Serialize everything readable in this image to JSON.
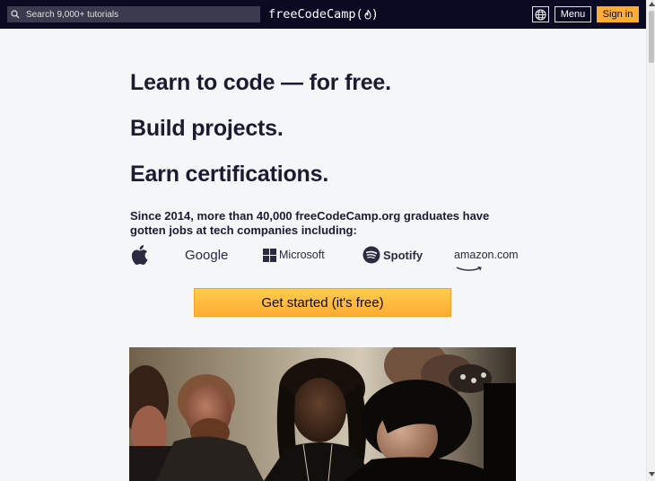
{
  "header": {
    "search_placeholder": "Search 9,000+ tutorials",
    "brand": "freeCodeCamp",
    "brand_suffix": "(",
    "brand_suffix_close": ")",
    "menu_label": "Menu",
    "signin_label": "Sign in",
    "icons": {
      "search": "search-icon",
      "globe": "globe-icon",
      "flame": "flame-icon"
    }
  },
  "hero": {
    "headline_1": "Learn to code — for free.",
    "headline_2": "Build projects.",
    "headline_3": "Earn certifications.",
    "intro": "Since 2014, more than 40,000 freeCodeCamp.org graduates have gotten jobs at tech companies including:",
    "companies": {
      "apple": "apple-logo",
      "google": "Google",
      "microsoft": "Microsoft",
      "spotify": "Spotify",
      "amazon": "amazon.com"
    },
    "cta_label": "Get started (it's free)"
  },
  "colors": {
    "nav_bg": "#0a0a23",
    "page_bg": "#f5f6f7",
    "text": "#1b1b32",
    "accent": "#feac32",
    "search_bg": "#3b3b4f"
  }
}
